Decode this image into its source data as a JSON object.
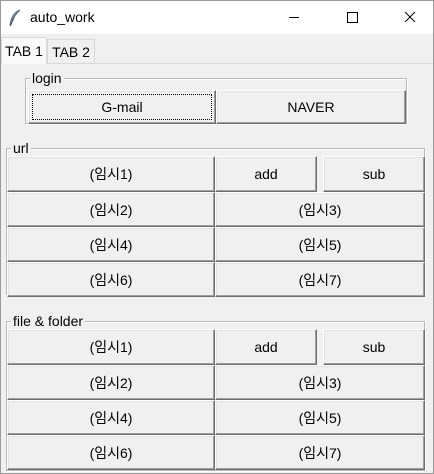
{
  "window": {
    "title": "auto_work"
  },
  "icons": {
    "app": "feather-icon",
    "minimize": "minimize-icon",
    "maximize": "maximize-icon",
    "close": "close-icon"
  },
  "tabs": [
    {
      "label": "TAB 1",
      "selected": true
    },
    {
      "label": "TAB 2",
      "selected": false
    }
  ],
  "login": {
    "label": "login",
    "gmail": "G-mail",
    "naver": "NAVER"
  },
  "url": {
    "label": "url",
    "btn1": "(임시1)",
    "add": "add",
    "sub": "sub",
    "btn2": "(임시2)",
    "btn3": "(임시3)",
    "btn4": "(임시4)",
    "btn5": "(임시5)",
    "btn6": "(임시6)",
    "btn7": "(임시7)"
  },
  "file": {
    "label": "file & folder",
    "btn1": "(임시1)",
    "add": "add",
    "sub": "sub",
    "btn2": "(임시2)",
    "btn3": "(임시3)",
    "btn4": "(임시4)",
    "btn5": "(임시5)",
    "btn6": "(임시6)",
    "btn7": "(임시7)"
  }
}
